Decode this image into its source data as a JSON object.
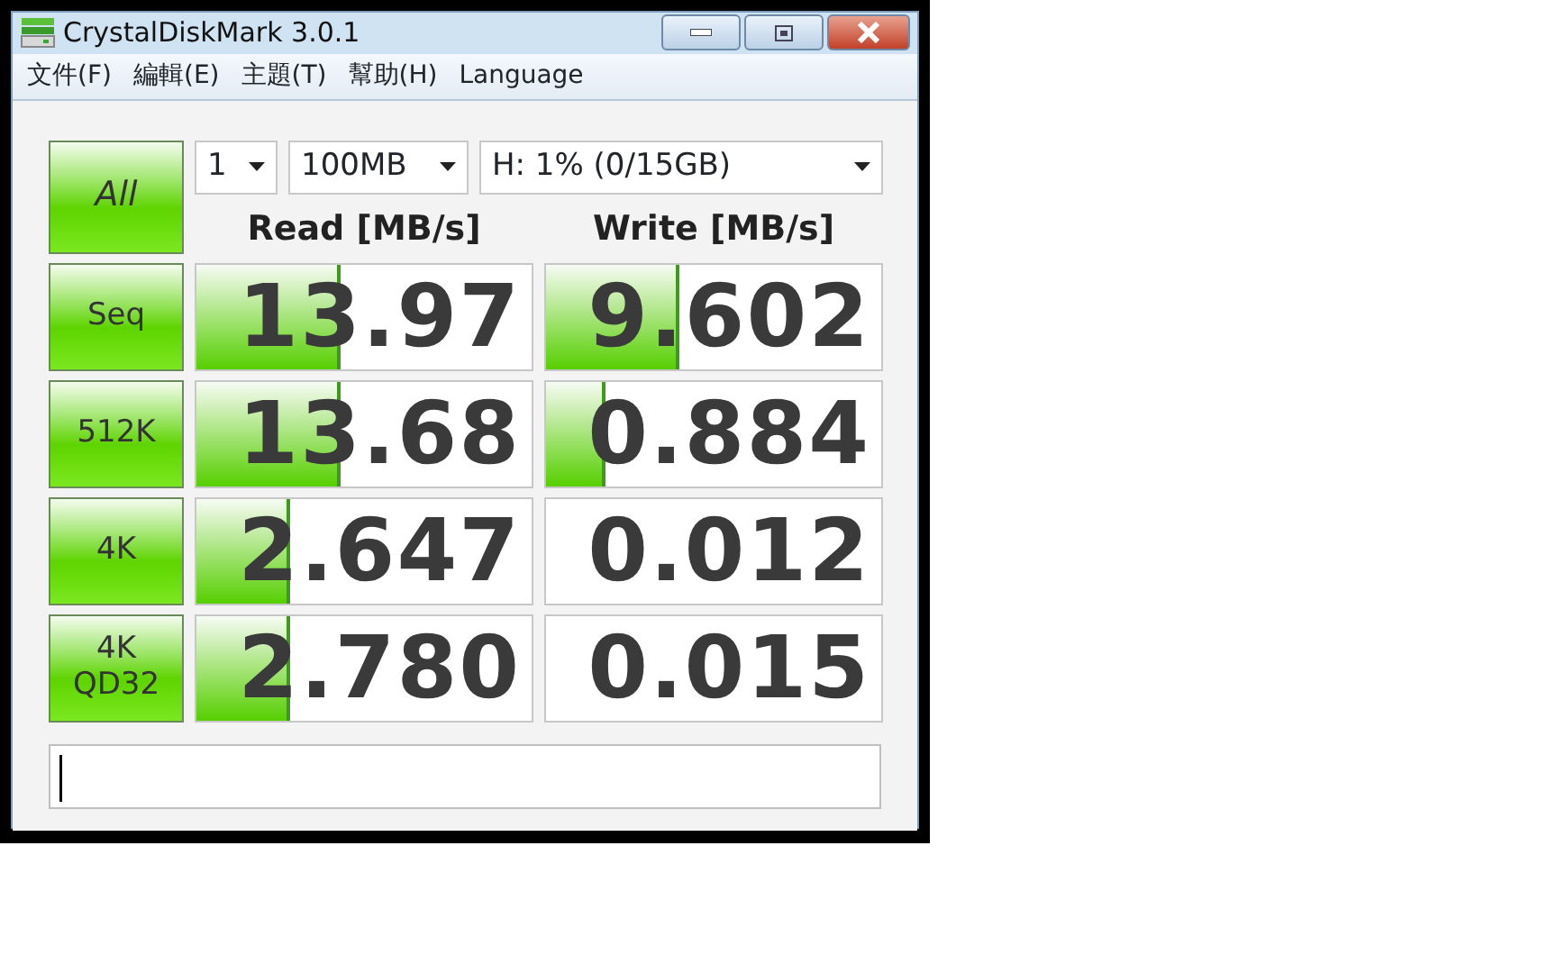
{
  "window": {
    "title": "CrystalDiskMark 3.0.1"
  },
  "menu": [
    "文件(F)",
    "編輯(E)",
    "主題(T)",
    "幫助(H)",
    "Language"
  ],
  "controls": {
    "all_button": "All",
    "count": "1",
    "size": "100MB",
    "drive": "H: 1% (0/15GB)"
  },
  "columns": [
    "Read [MB/s]",
    "Write [MB/s]"
  ],
  "rows": [
    {
      "label": "Seq",
      "read": {
        "value": "13.97",
        "level": 0.43
      },
      "write": {
        "value": "9.602",
        "level": 0.4
      }
    },
    {
      "label": "512K",
      "read": {
        "value": "13.68",
        "level": 0.43
      },
      "write": {
        "value": "0.884",
        "level": 0.18
      }
    },
    {
      "label": "4K",
      "read": {
        "value": "2.647",
        "level": 0.28
      },
      "write": {
        "value": "0.012"
      }
    },
    {
      "label": "4K\nQD32",
      "read": {
        "value": "2.780",
        "level": 0.28
      },
      "write": {
        "value": "0.015"
      }
    }
  ]
}
